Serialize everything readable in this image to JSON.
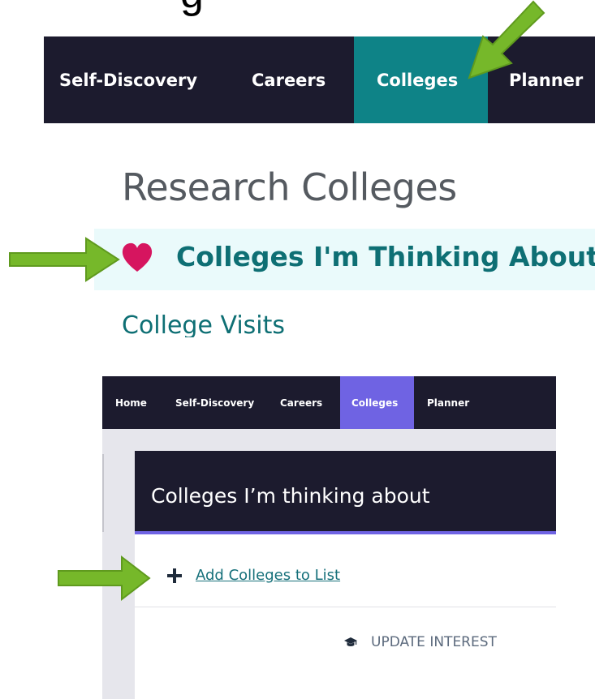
{
  "fragment": {
    "top_text": "g"
  },
  "top_nav": {
    "items": [
      {
        "label": "Self-Discovery"
      },
      {
        "label": "Careers"
      },
      {
        "label": "Colleges"
      },
      {
        "label": "Planner"
      }
    ],
    "active": "Colleges",
    "active_color": "#0e8387",
    "bg_color": "#1c1b2e"
  },
  "menu": {
    "title": "Research Colleges",
    "thinking_label": "Colleges I'm Thinking About",
    "thinking_icon": "heart-icon",
    "heart_color": "#d6155f",
    "visits_label": "College Visits"
  },
  "bottom_nav": {
    "items": [
      {
        "label": "Home"
      },
      {
        "label": "Self-Discovery"
      },
      {
        "label": "Careers"
      },
      {
        "label": "Colleges"
      },
      {
        "label": "Planner"
      }
    ],
    "active": "Colleges",
    "active_color": "#6f63e3"
  },
  "card": {
    "title": "Colleges I’m thinking about",
    "add_link": "Add Colleges to List",
    "add_icon": "plus-icon",
    "update_label": "UPDATE INTEREST",
    "update_icon": "graduation-cap-icon"
  },
  "annotations": {
    "arrow_color": "#76b82a",
    "arrow_icon": "green-arrow-icon"
  }
}
